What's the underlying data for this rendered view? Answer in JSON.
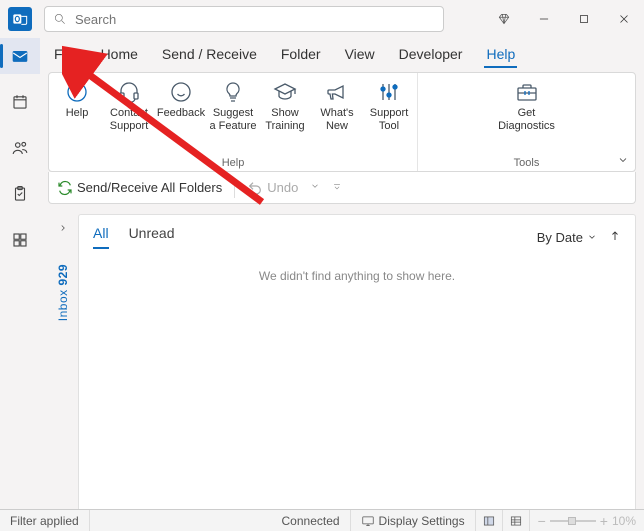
{
  "search": {
    "placeholder": "Search"
  },
  "menu": {
    "file": "File",
    "home": "Home",
    "sendreceive": "Send / Receive",
    "folder": "Folder",
    "view": "View",
    "developer": "Developer",
    "help": "Help"
  },
  "ribbon": {
    "help": "Help",
    "contact_support": "Contact\nSupport",
    "feedback": "Feedback",
    "suggest_feature": "Suggest\na Feature",
    "show_training": "Show\nTraining",
    "whats_new": "What's\nNew",
    "support_tool": "Support\nTool",
    "get_diagnostics": "Get\nDiagnostics",
    "group_help": "Help",
    "group_tools": "Tools"
  },
  "quick": {
    "send_receive_all": "Send/Receive All Folders",
    "undo": "Undo"
  },
  "folder": {
    "name": "Inbox",
    "count": "929"
  },
  "filters": {
    "all": "All",
    "unread": "Unread",
    "sort": "By Date"
  },
  "body": {
    "empty": "We didn't find anything to show here."
  },
  "status": {
    "filter": "Filter applied",
    "connected": "Connected",
    "display": "Display Settings",
    "zoom": "10%"
  }
}
